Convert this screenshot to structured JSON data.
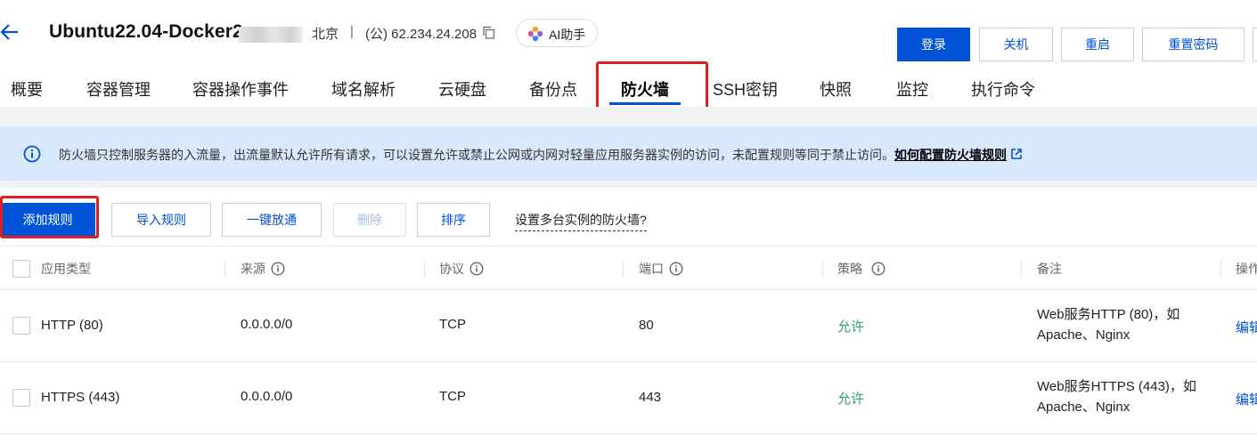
{
  "header": {
    "title": "Ubuntu22.04-Docker2",
    "region": "北京",
    "separator": "|",
    "ip": "(公) 62.234.24.208",
    "ai_button": "AI助手",
    "buttons": [
      "登录",
      "关机",
      "重启",
      "重置密码"
    ]
  },
  "tabs": [
    "概要",
    "容器管理",
    "容器操作事件",
    "域名解析",
    "云硬盘",
    "备份点",
    "防火墙",
    "SSH密钥",
    "快照",
    "监控",
    "执行命令"
  ],
  "active_tab": "防火墙",
  "notice": {
    "text": "防火墙只控制服务器的入流量，出流量默认允许所有请求，可以设置允许或禁止公网或内网对轻量应用服务器实例的访问，未配置规则等同于禁止访问。",
    "link": "如何配置防火墙规则"
  },
  "toolbar": {
    "add_rule": "添加规则",
    "import_rules": "导入规则",
    "one_click_open": "一键放通",
    "delete": "删除",
    "sort": "排序",
    "multi_instance_link": "设置多台实例的防火墙?"
  },
  "table": {
    "columns": [
      "应用类型",
      "来源",
      "协议",
      "端口",
      "策略",
      "备注",
      "操作"
    ],
    "rows": [
      {
        "app": "HTTP (80)",
        "source": "0.0.0.0/0",
        "protocol": "TCP",
        "port": "80",
        "policy": "允许",
        "note_line1": "Web服务HTTP (80)，如",
        "note_line2": "Apache、Nginx",
        "op": "编辑"
      },
      {
        "app": "HTTPS (443)",
        "source": "0.0.0.0/0",
        "protocol": "TCP",
        "port": "443",
        "policy": "允许",
        "note_line1": "Web服务HTTPS (443)，如",
        "note_line2": "Apache、Nginx",
        "op": "编辑"
      }
    ]
  },
  "colors": {
    "primary": "#0052d9",
    "highlight": "#e02020",
    "allow": "#2ba471",
    "notice_bg": "#d9e8fc"
  }
}
